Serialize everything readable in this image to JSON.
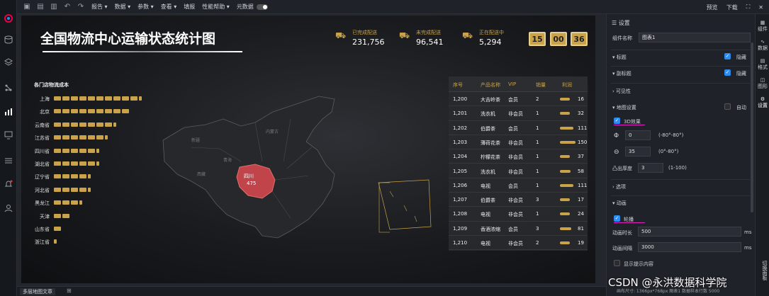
{
  "toolbar": {
    "menus": [
      "报告",
      "数据",
      "参数",
      "查看",
      "填报",
      "性能帮助",
      "元数据"
    ],
    "preview": "预览",
    "download": "下载"
  },
  "dashboard": {
    "title": "全国物流中心运输状态统计图",
    "stats": [
      {
        "label": "已完成配送",
        "value": "231,756"
      },
      {
        "label": "未完成配送",
        "value": "96,541"
      },
      {
        "label": "正在配送中",
        "value": "5,294"
      }
    ],
    "clock": [
      "15",
      "00",
      "36"
    ],
    "bar_title": "各门店物流成本",
    "map_highlight": {
      "name": "四川",
      "value": "475"
    },
    "map_labels": [
      "新疆",
      "西藏",
      "青海",
      "四川",
      "内蒙古"
    ]
  },
  "chart_data": {
    "type": "bar",
    "title": "各门店物流成本",
    "categories": [
      "上海",
      "北京",
      "云南省",
      "江苏省",
      "四川省",
      "湖北省",
      "辽宁省",
      "河北省",
      "黑龙江",
      "天津",
      "山东省",
      "浙江省"
    ],
    "values": [
      10.5,
      9.2,
      7.6,
      6.8,
      5.6,
      5.2,
      4.9,
      4.4,
      3.2,
      2.1,
      1.1,
      0.5
    ]
  },
  "table": {
    "headers": [
      "序号",
      "产品名称",
      "VIP",
      "销量",
      "利润"
    ],
    "rows": [
      [
        "1,200",
        "大吉岭茶",
        "会员",
        "2",
        "16"
      ],
      [
        "1,201",
        "洗衣机",
        "非会员",
        "1",
        "32"
      ],
      [
        "1,202",
        "伯爵茶",
        "会员",
        "1",
        "111"
      ],
      [
        "1,203",
        "薄荷花茶",
        "非会员",
        "1",
        "150"
      ],
      [
        "1,204",
        "柠檬花茶",
        "非会员",
        "1",
        "37"
      ],
      [
        "1,205",
        "洗衣机",
        "非会员",
        "1",
        "58"
      ],
      [
        "1,206",
        "电视",
        "会员",
        "1",
        "111"
      ],
      [
        "1,207",
        "伯爵茶",
        "非会员",
        "3",
        "17"
      ],
      [
        "1,208",
        "电视",
        "非会员",
        "1",
        "24"
      ],
      [
        "1,209",
        "香酒浓缩",
        "会员",
        "3",
        "81"
      ],
      [
        "1,210",
        "电视",
        "非会员",
        "2",
        "19"
      ]
    ]
  },
  "panel": {
    "header": "设置",
    "component_name_label": "组件名称",
    "component_name": "图表1",
    "title_label": "标题",
    "subtitle_label": "副标题",
    "hide": "隐藏",
    "visibility": "可见性",
    "map_settings": "地图设置",
    "auto": "自动",
    "effect3d": "3D效果",
    "angle1": "0",
    "angle1_range": "(-80°-80°)",
    "angle2": "35",
    "angle2_range": "(0°-80°)",
    "thickness_label": "凸出厚度",
    "thickness": "3",
    "thickness_range": "(1-100)",
    "options": "选项",
    "animation": "动画",
    "carousel": "轮播",
    "anim_duration_label": "动画时长",
    "anim_duration": "500",
    "anim_interval_label": "动画间隔",
    "anim_interval": "3000",
    "ms": "ms",
    "show_tip": "显示提示内容"
  },
  "right_tabs": [
    "组件",
    "数据",
    "格式",
    "图形",
    "设置",
    "切换面板"
  ],
  "status": {
    "tab": "多层地图文章",
    "info": "画布尺寸: 1366px*768px   图表1   数据样本行数 5000"
  },
  "watermark": "CSDN @永洪数据科学院"
}
